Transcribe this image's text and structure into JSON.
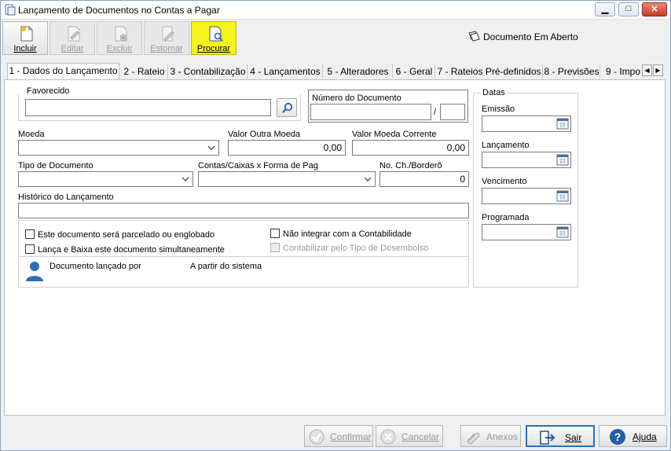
{
  "window": {
    "title": "Lançamento de Documentos no Contas a Pagar",
    "controls": {
      "minimize": "▁",
      "maximize": "□",
      "close": "✕"
    }
  },
  "toolbar": {
    "buttons": [
      {
        "label": "Incluir",
        "icon": "new-document-icon",
        "enabled": true
      },
      {
        "label": "Editar",
        "icon": "edit-document-icon",
        "enabled": false
      },
      {
        "label": "Excluir",
        "icon": "delete-document-icon",
        "enabled": false
      },
      {
        "label": "Estornar",
        "icon": "reverse-document-icon",
        "enabled": false
      },
      {
        "label": "Procurar",
        "icon": "search-document-icon",
        "enabled": true,
        "highlight": "#f3f31f"
      }
    ],
    "status": "Documento Em Aberto"
  },
  "tabs": [
    {
      "label": "1 - Dados do Lançamento",
      "active": true
    },
    {
      "label": "2 - Rateio"
    },
    {
      "label": "3 - Contabilização"
    },
    {
      "label": "4 - Lançamentos"
    },
    {
      "label": "5 - Alteradores"
    },
    {
      "label": "6 - Geral"
    },
    {
      "label": "7 - Rateios Pré-definidos"
    },
    {
      "label": "8 - Previsões"
    },
    {
      "label": "9 - Impo"
    }
  ],
  "tab_scroll": {
    "left": "◀",
    "right": "▶"
  },
  "form": {
    "favorecido": {
      "label": "Favorecido",
      "value": ""
    },
    "numero_documento": {
      "label": "Número do Documento",
      "value": "",
      "separator": "/",
      "suffix": ""
    },
    "moeda": {
      "label": "Moeda",
      "value": ""
    },
    "valor_outra_moeda": {
      "label": "Valor Outra Moeda",
      "value": "0,00"
    },
    "valor_moeda_corrente": {
      "label": "Valor Moeda Corrente",
      "value": "0,00"
    },
    "tipo_documento": {
      "label": "Tipo de Documento",
      "value": ""
    },
    "contas_caixas": {
      "label": "Contas/Caixas x Forma de Pag",
      "value": ""
    },
    "no_ch_bordero": {
      "label": "No. Ch./Borderô",
      "value": "0"
    },
    "historico": {
      "label": "Histórico do Lançamento",
      "value": ""
    },
    "checks": {
      "parcelado": {
        "label": "Este documento será parcelado ou englobado",
        "checked": false
      },
      "lanca_baixa": {
        "label": "Lança e Baixa este documento simultaneamente",
        "checked": false
      },
      "nao_integrar": {
        "label": "Não integrar com a Contabilidade",
        "checked": false
      },
      "contabilizar_tipo": {
        "label": "Contabilizar pelo Tipo de Desembolso",
        "checked": false,
        "enabled": false
      }
    },
    "lancado_por": {
      "label": "Documento lançado por",
      "value": "A partir do sistema"
    }
  },
  "datas": {
    "title": "Datas",
    "fields": [
      {
        "label": "Emissão",
        "value": ""
      },
      {
        "label": "Lançamento",
        "value": ""
      },
      {
        "label": "Vencimento",
        "value": ""
      },
      {
        "label": "Programada",
        "value": ""
      }
    ]
  },
  "bottom_buttons": [
    {
      "label": "Confirmar",
      "icon": "check-circle-icon",
      "enabled": false
    },
    {
      "label": "Cancelar",
      "icon": "cancel-circle-icon",
      "enabled": false
    },
    {
      "label": "Anexos",
      "icon": "paperclip-icon",
      "enabled": false
    },
    {
      "label": "Sair",
      "icon": "exit-door-icon",
      "enabled": true
    },
    {
      "label": "Ajuda",
      "icon": "help-icon",
      "enabled": true
    }
  ]
}
